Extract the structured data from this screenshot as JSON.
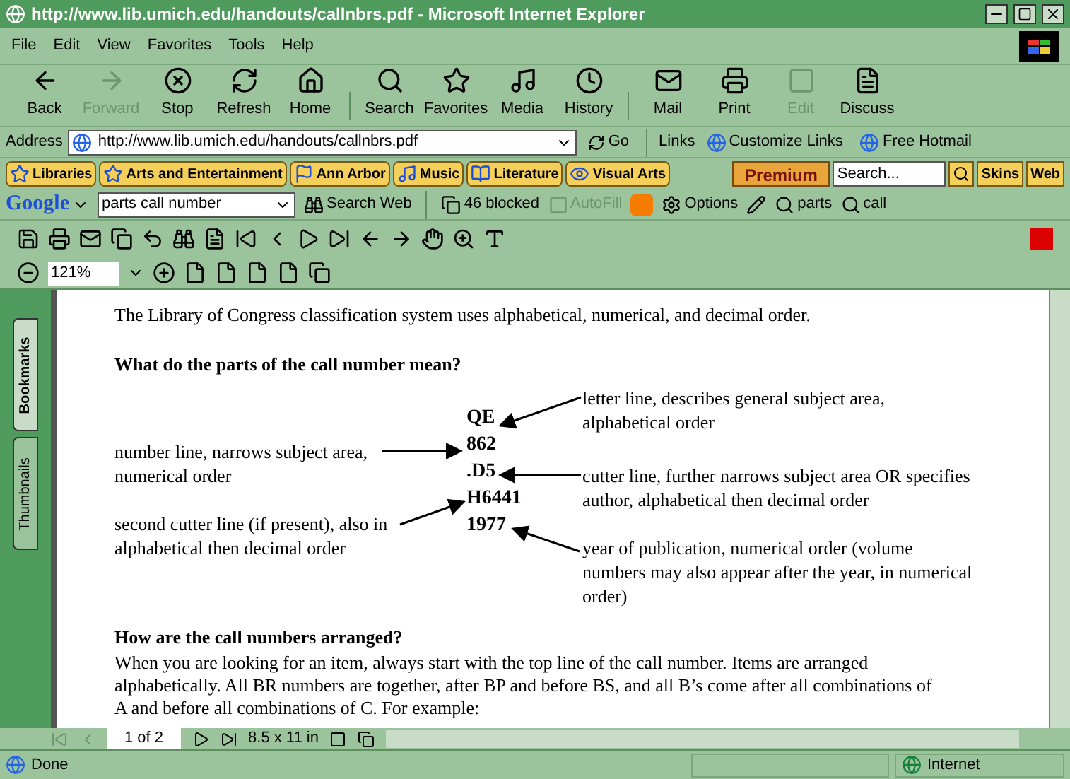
{
  "window": {
    "title": "http://www.lib.umich.edu/handouts/callnbrs.pdf - Microsoft Internet Explorer"
  },
  "menu": [
    "File",
    "Edit",
    "View",
    "Favorites",
    "Tools",
    "Help"
  ],
  "toolbar": [
    {
      "label": "Back",
      "disabled": false
    },
    {
      "label": "Forward",
      "disabled": true
    },
    {
      "label": "Stop",
      "disabled": false
    },
    {
      "label": "Refresh",
      "disabled": false
    },
    {
      "label": "Home",
      "disabled": false
    },
    {
      "label": "Search",
      "disabled": false
    },
    {
      "label": "Favorites",
      "disabled": false
    },
    {
      "label": "Media",
      "disabled": false
    },
    {
      "label": "History",
      "disabled": false
    },
    {
      "label": "Mail",
      "disabled": false
    },
    {
      "label": "Print",
      "disabled": false
    },
    {
      "label": "Edit",
      "disabled": true
    },
    {
      "label": "Discuss",
      "disabled": false
    }
  ],
  "address": {
    "label": "Address",
    "value": "http://www.lib.umich.edu/handouts/callnbrs.pdf",
    "go": "Go",
    "links_label": "Links",
    "links": [
      "Customize Links",
      "Free Hotmail"
    ]
  },
  "links_bar": {
    "items": [
      "Libraries",
      "Arts and Entertainment",
      "Ann Arbor",
      "Music",
      "Literature",
      "Visual Arts"
    ],
    "premium": "Premium",
    "search_placeholder": "Search...",
    "buttons": [
      "Skins",
      "Web"
    ]
  },
  "google_bar": {
    "logo": "Google",
    "query": "parts call number",
    "search": "Search Web",
    "blocked": "46 blocked",
    "autofill": "AutoFill",
    "options": "Options",
    "terms": [
      "parts",
      "call"
    ]
  },
  "reader": {
    "zoom": "121%",
    "side_tabs": [
      {
        "label": "Bookmarks",
        "selected": true
      },
      {
        "label": "Thumbnails",
        "selected": false
      }
    ],
    "page": "1 of 2",
    "page_size": "8.5 x 11 in"
  },
  "document": {
    "intro": "The Library of Congress classification system uses alphabetical, numerical, and decimal order.",
    "heading_1": "What do the parts of the call number mean?",
    "call_number": [
      "QE",
      "862",
      ".D5",
      "H6441",
      "1977"
    ],
    "labels": [
      {
        "lines": [
          "letter line, describes general subject area,",
          "alphabetical order"
        ]
      },
      {
        "lines": [
          "number line, narrows subject area,",
          "numerical order"
        ]
      },
      {
        "lines": [
          "cutter line, further narrows subject area OR specifies",
          "author, alphabetical then decimal order"
        ]
      },
      {
        "lines": [
          "second cutter line (if present), also in",
          "alphabetical then decimal order"
        ]
      },
      {
        "lines": [
          "year of publication, numerical order (volume",
          "numbers may also appear after the year, in numerical",
          "order)"
        ]
      }
    ],
    "heading_2": "How are the call numbers arranged?",
    "paragraph": [
      "When you are looking for an item, always start with the top line of the call number.  Items are arranged",
      "alphabetically.  All BR numbers are together, after BP and before BS, and all B’s come after all combinations of",
      "A and before all combinations of C.  For example:"
    ]
  },
  "status": {
    "text": "Done",
    "zone": "Internet"
  }
}
